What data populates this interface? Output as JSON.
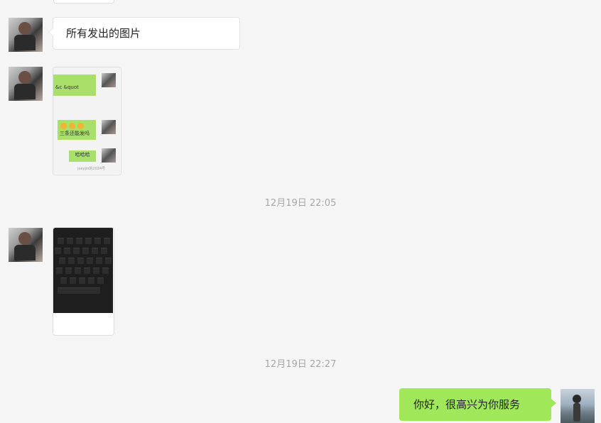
{
  "messages": {
    "text_msg_1": "所有发出的图片",
    "thumb_line_1": "&c &quot",
    "thumb_line_2": "三条还能发吗",
    "thumb_line_3": "哈哈哈",
    "thumb_footer": "joeyjin的2024号",
    "timestamp_1": "12月19日 22:05",
    "timestamp_2": "12月19日 22:27",
    "reply_msg": "你好，很高兴为你服务"
  },
  "colors": {
    "background": "#f5f5f5",
    "my_bubble": "#a0e75a",
    "other_bubble": "#ffffff",
    "timestamp_text": "#a6a6a6"
  }
}
